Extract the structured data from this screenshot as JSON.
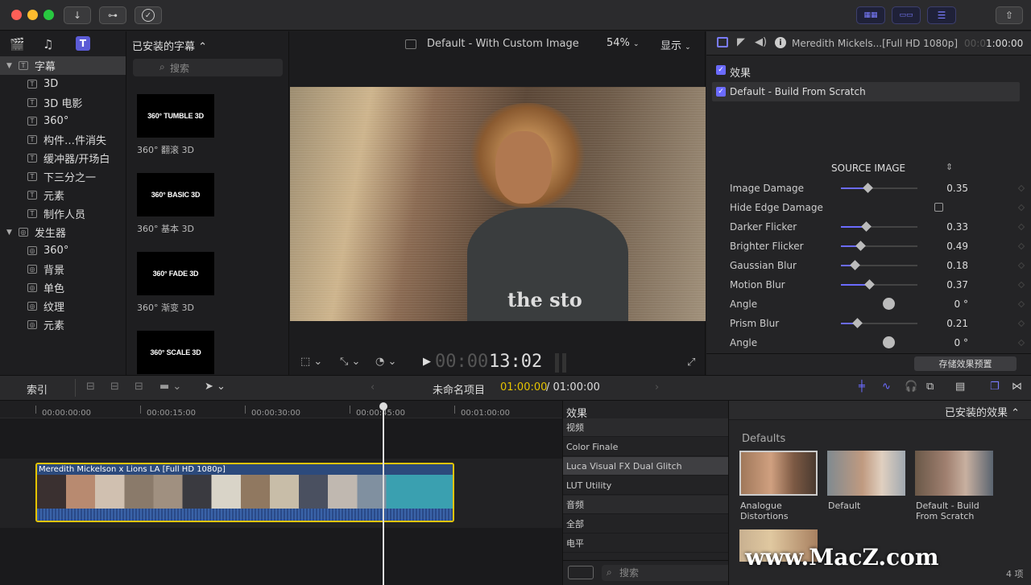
{
  "titlebar": {
    "btn_import": "↓",
    "btn_keywords": "⊶",
    "btn_check": "✓"
  },
  "library": {
    "items": [
      {
        "label": "字幕",
        "type": "folder",
        "expanded": true,
        "selected": true
      },
      {
        "label": "3D"
      },
      {
        "label": "3D 电影"
      },
      {
        "label": "360°"
      },
      {
        "label": "构件…件消失"
      },
      {
        "label": "缓冲器/开场白"
      },
      {
        "label": "下三分之一"
      },
      {
        "label": "元素"
      },
      {
        "label": "制作人员"
      },
      {
        "label": "发生器",
        "type": "folder",
        "expanded": true
      },
      {
        "label": "360°"
      },
      {
        "label": "背景"
      },
      {
        "label": "单色"
      },
      {
        "label": "纹理"
      },
      {
        "label": "元素"
      }
    ]
  },
  "browser": {
    "title": "已安装的字幕 ⌃",
    "search_placeholder": "搜索",
    "items": [
      {
        "thumb": "360° TUMBLE 3D",
        "label": "360° 翻滚 3D"
      },
      {
        "thumb": "360° BASIC 3D",
        "label": "360° 基本 3D"
      },
      {
        "thumb": "360° FADE 3D",
        "label": "360° 渐变 3D"
      },
      {
        "thumb": "360° SCALE 3D",
        "label": ""
      }
    ]
  },
  "viewer": {
    "title": "Default - With Custom Image",
    "zoom": "54%",
    "display": "显示",
    "timecode_dim": "00:00",
    "timecode": "13:02",
    "image_text": "the sto"
  },
  "inspector": {
    "clip_name": "Meredith Mickels...[Full HD 1080p]",
    "tc_dim": "00:0",
    "tc": "1:00:00",
    "effects_label": "效果",
    "effect_name": "Default - Build From Scratch",
    "source_image": "SOURCE IMAGE",
    "params": [
      {
        "name": "Image Damage",
        "value": "0.35",
        "type": "slider",
        "level": 0.35
      },
      {
        "name": "Hide Edge Damage",
        "value": "",
        "type": "checkbox"
      },
      {
        "name": "Darker Flicker",
        "value": "0.33",
        "type": "slider",
        "level": 0.33
      },
      {
        "name": "Brighter Flicker",
        "value": "0.49",
        "type": "slider",
        "level": 0.25
      },
      {
        "name": "Gaussian Blur",
        "value": "0.18",
        "type": "slider",
        "level": 0.18
      },
      {
        "name": "Motion Blur",
        "value": "0.37",
        "type": "slider",
        "level": 0.37
      },
      {
        "name": "Angle",
        "value": "0 °",
        "type": "dial"
      },
      {
        "name": "Prism Blur",
        "value": "0.21",
        "type": "slider",
        "level": 0.21
      },
      {
        "name": "Angle",
        "value": "0 °",
        "type": "dial"
      }
    ],
    "save_preset": "存储效果预置"
  },
  "timeline_bar": {
    "index": "索引",
    "project": "未命名项目",
    "tc_current": "01:00:00",
    "tc_total": "/ 01:00:00"
  },
  "timeline": {
    "ruler": [
      "00:00:00:00",
      "00:00:15:00",
      "00:00:30:00",
      "00:00:45:00",
      "00:01:00:00"
    ],
    "clip_title": "Meredith Mickelson x Lions LA [Full HD 1080p]"
  },
  "effects": {
    "header": "效果",
    "rows": [
      {
        "label": "视频",
        "hdr": true
      },
      {
        "label": "Color Finale"
      },
      {
        "label": "Luca Visual FX Dual Glitch",
        "sel": true
      },
      {
        "label": "LUT Utility"
      },
      {
        "label": "音频",
        "hdr": true
      },
      {
        "label": "全部"
      },
      {
        "label": "电平"
      }
    ],
    "search_placeholder": "搜索"
  },
  "effects_browser": {
    "title": "已安装的效果 ⌃",
    "section": "Defaults",
    "items": [
      {
        "label": "Analogue Distortions"
      },
      {
        "label": "Default"
      },
      {
        "label": "Default - Build From Scratch"
      }
    ],
    "footer": "4 项",
    "watermark": "www.MacZ.com"
  },
  "colors": {
    "accent": "#6b6bff",
    "clip_border": "#e5c400",
    "clip_title_bg": "#2c4a7c"
  }
}
